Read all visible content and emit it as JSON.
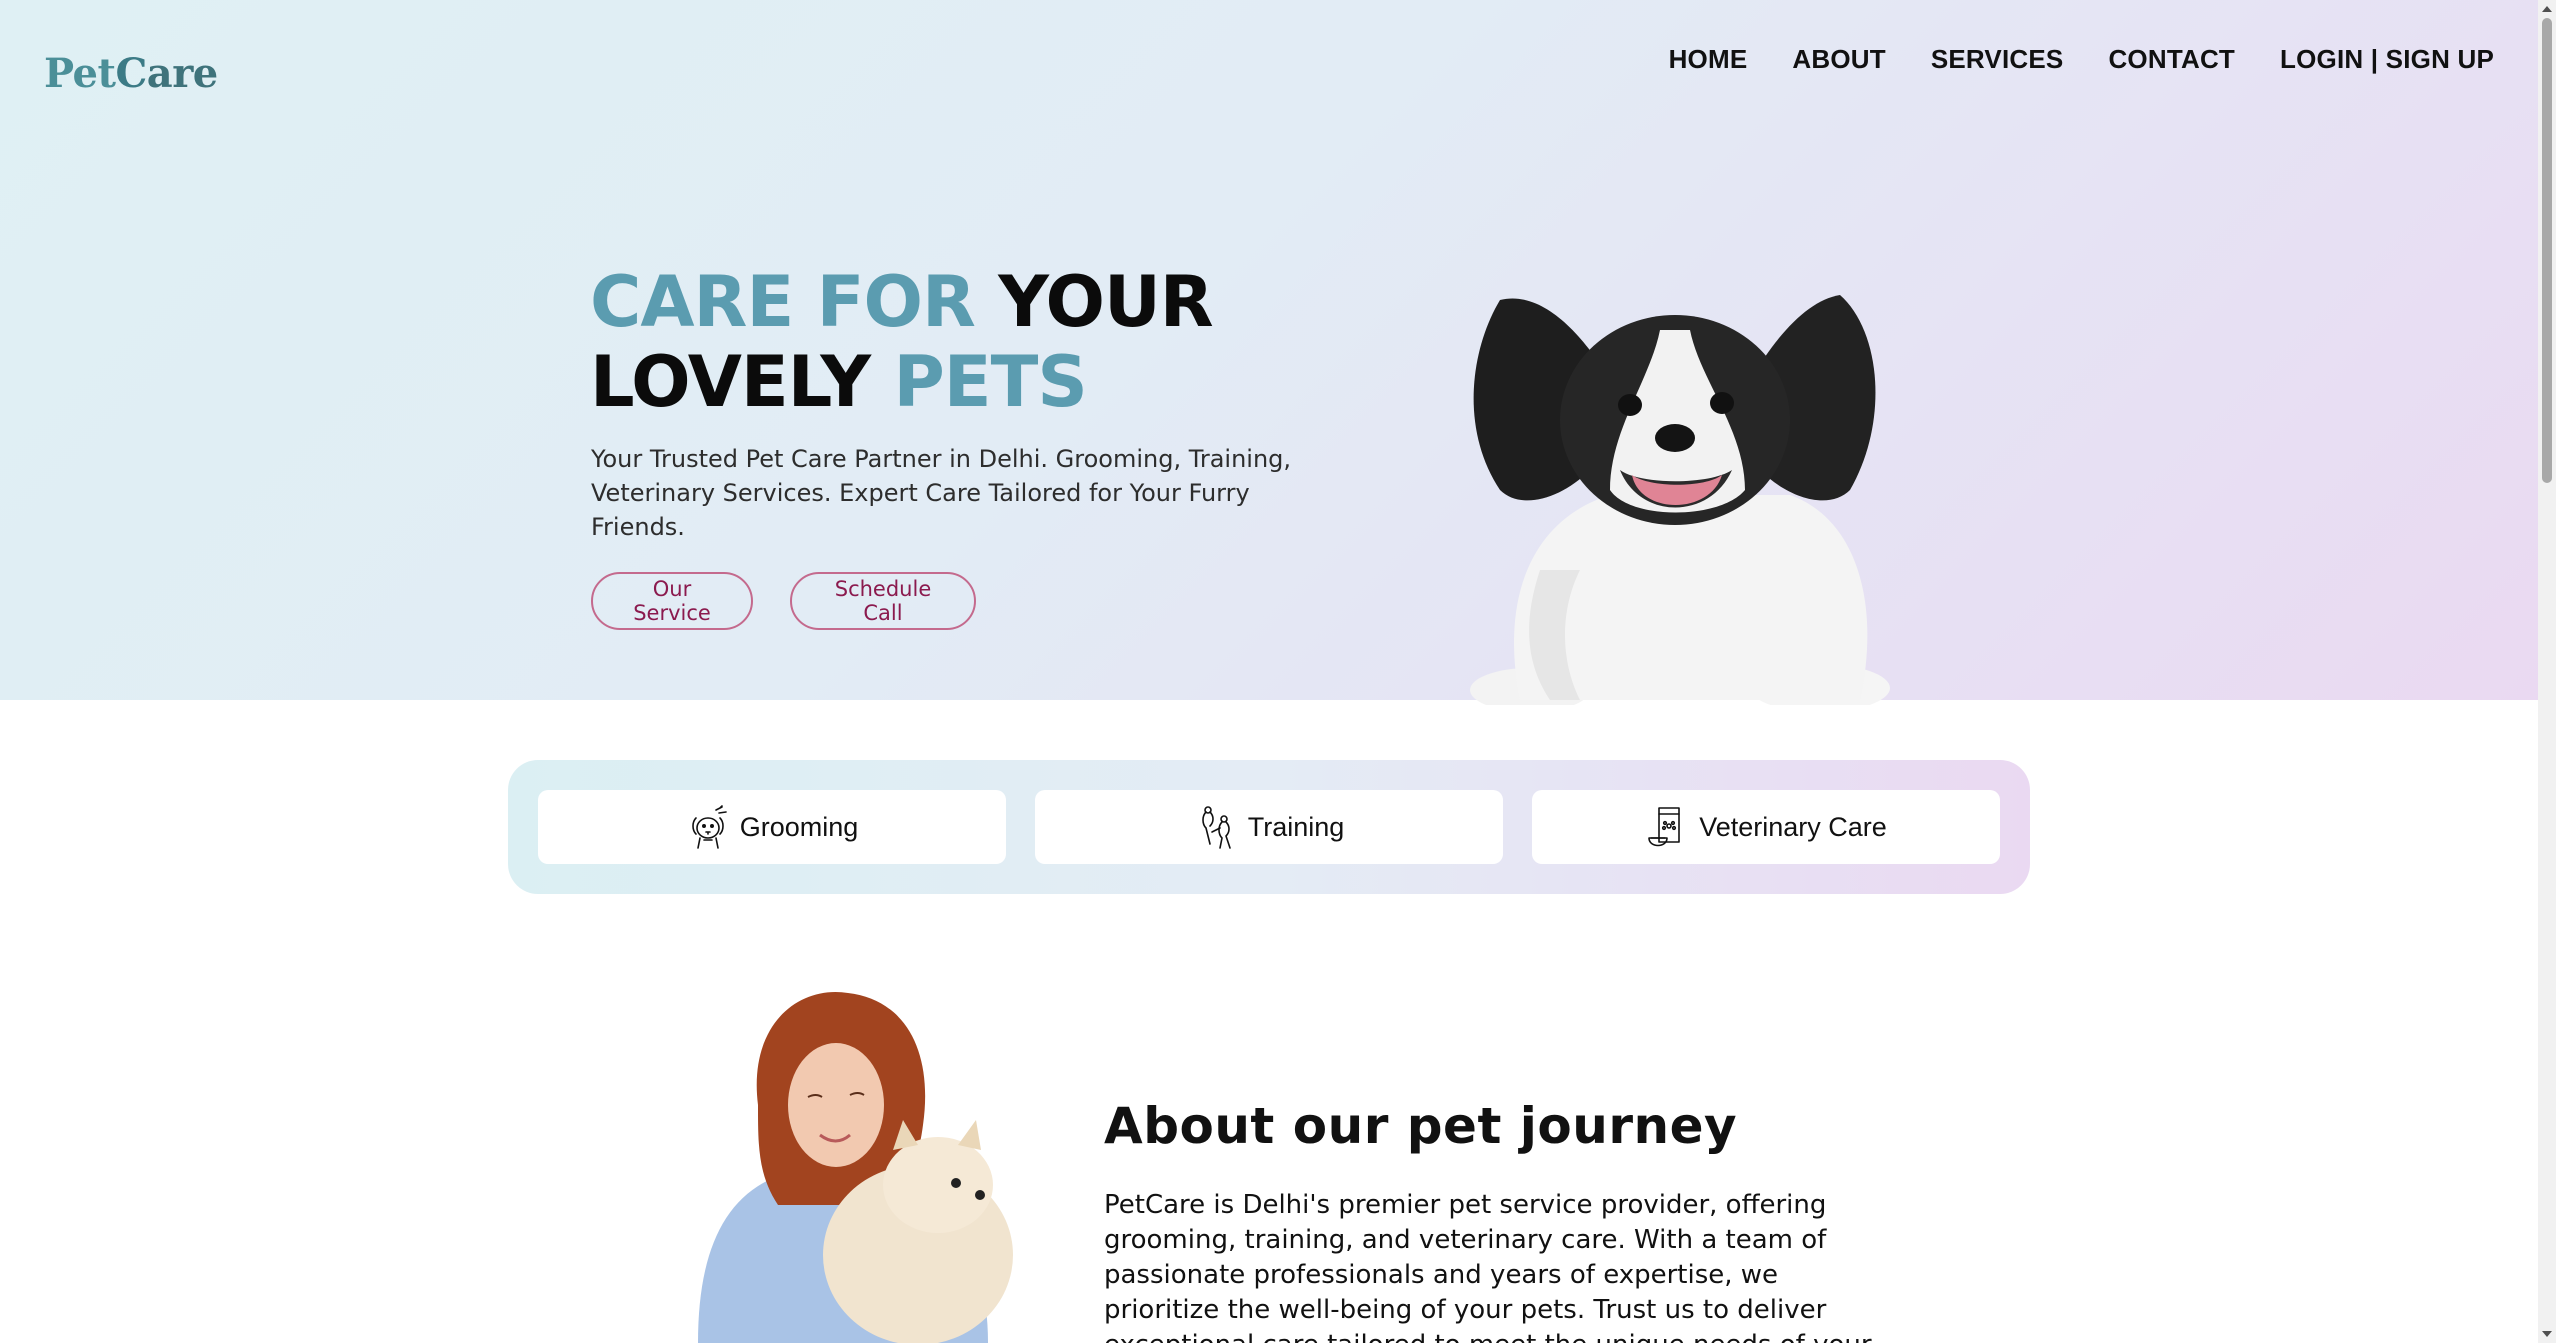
{
  "brand": {
    "logo_part1": "Pet",
    "logo_part2": "C",
    "logo_part3": "are"
  },
  "nav": {
    "items": [
      {
        "label": "HOME"
      },
      {
        "label": "ABOUT"
      },
      {
        "label": "SERVICES"
      },
      {
        "label": "CONTACT"
      },
      {
        "label": "LOGIN | SIGN UP"
      }
    ]
  },
  "hero": {
    "headline_1": "CARE FOR",
    "headline_2": "YOUR",
    "headline_3": "LOVELY",
    "headline_4": "PETS",
    "subtitle": "Your Trusted Pet Care Partner in Delhi. Grooming, Training, Veterinary Services. Expert Care Tailored for Your Furry Friends.",
    "buttons": {
      "service": "Our Service",
      "call": "Schedule Call"
    },
    "image_icon": "papillon-dog-photo"
  },
  "services": [
    {
      "label": "Grooming",
      "icon": "grooming-dog-icon"
    },
    {
      "label": "Training",
      "icon": "training-hands-icon"
    },
    {
      "label": "Veterinary Care",
      "icon": "vet-pet-food-icon"
    }
  ],
  "about": {
    "title": "About our pet journey",
    "text": "PetCare is Delhi's premier pet service provider, offering grooming, training, and veterinary care. With a team of passionate professionals and years of expertise, we prioritize the well-being of your pets. Trust us to deliver exceptional care tailored to meet the unique needs of your furry companions.",
    "image_icon": "woman-holding-pomeranian-photo"
  },
  "colors": {
    "accent_teal": "#5b9cb0",
    "button_border": "#c46a8d",
    "button_text": "#8b1a4e",
    "hero_gradient_start": "#dff0f4",
    "hero_gradient_end": "#ead9f2"
  }
}
